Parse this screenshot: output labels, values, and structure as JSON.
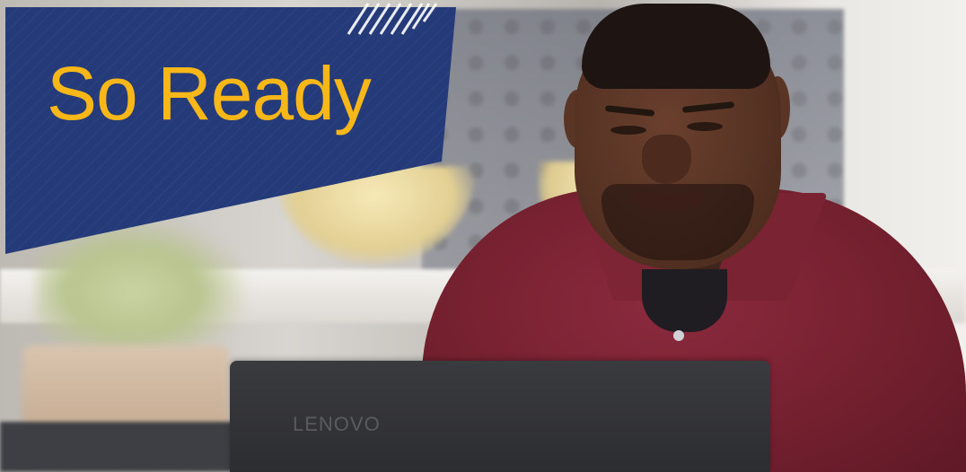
{
  "banner": {
    "title": "So Ready",
    "colors": {
      "background": "#253a78",
      "title": "#f7b718",
      "accent_stripes": "#ffffff"
    }
  },
  "photo": {
    "laptop_logo": "LENOVO",
    "colors": {
      "shirt": "#7a2333",
      "laptop": "#2f3033"
    }
  }
}
